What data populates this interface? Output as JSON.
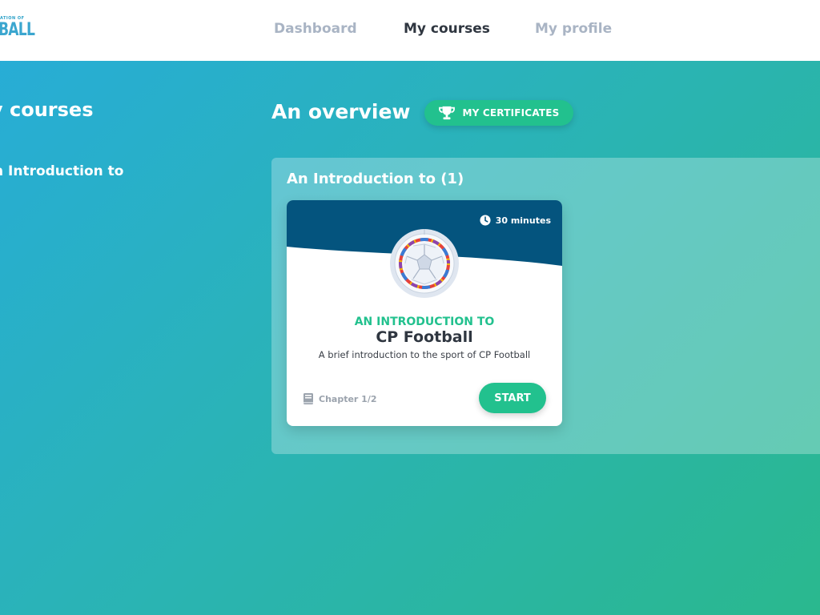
{
  "logo": {
    "small_text": "ATION OF",
    "big_text": "BALL"
  },
  "nav": {
    "items": [
      {
        "label": "Dashboard",
        "active": false
      },
      {
        "label": "My courses",
        "active": true
      },
      {
        "label": "My profile",
        "active": false
      }
    ]
  },
  "sidebar": {
    "title": "y courses",
    "items": [
      {
        "label": "n Introduction to"
      }
    ]
  },
  "overview": {
    "title": "An overview",
    "certificates_label": "MY CERTIFICATES",
    "certificates_icon": "trophy-icon"
  },
  "category": {
    "title": "An Introduction to (1)",
    "courses": [
      {
        "duration": "30 minutes",
        "subtitle": "AN INTRODUCTION TO",
        "name": "CP Football",
        "description": "A brief introduction to the sport of CP Football",
        "chapter": "Chapter 1/2",
        "start_label": "START",
        "icon": "soccer-ball-icon"
      }
    ]
  },
  "colors": {
    "accent": "#22c18e",
    "card_header": "#04547e",
    "nav_active": "#2f3640",
    "nav_inactive": "#a9b4c4",
    "gradient_start": "#27acd9",
    "gradient_end": "#2ab88e"
  }
}
